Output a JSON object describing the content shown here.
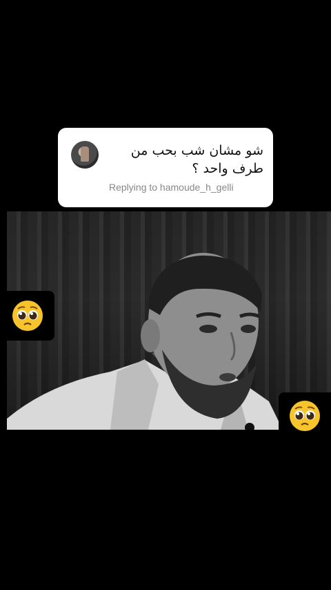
{
  "reply_card": {
    "question_text": "شو مشان شب بحب من طرف واحد ؟",
    "replying_label": "Replying to hamoude_h_gelli"
  },
  "stickers": {
    "left": "pleading-face-emoji",
    "right": "pleading-face-emoji"
  },
  "colors": {
    "background": "#000000",
    "card": "#ffffff",
    "replying_text": "#888888",
    "emoji_yellow": "#f7c42b"
  }
}
